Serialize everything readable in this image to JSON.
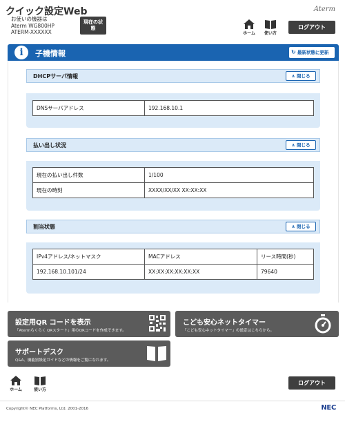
{
  "header": {
    "app_title": "クイック設定Web",
    "device_label": "お使いの機器は",
    "device_model": "Aterm WG800HP",
    "device_id": "ATERM-XXXXXX",
    "status_button": "現在の状態",
    "brand": "Aterm",
    "home_label": "ホーム",
    "help_label": "使い方",
    "logout_label": "ログアウト"
  },
  "main": {
    "title": "子機情報",
    "refresh_label": "最新状態に更新"
  },
  "sections": {
    "dhcp": {
      "title": "DHCPサーバ情報",
      "close_label": "閉じる",
      "rows": [
        {
          "label": "DNSサーバアドレス",
          "value": "192.168.10.1"
        }
      ]
    },
    "lease": {
      "title": "払い出し状況",
      "close_label": "閉じる",
      "rows": [
        {
          "label": "現在の払い出し件数",
          "value": "1/100"
        },
        {
          "label": "現在の時刻",
          "value": "XXXX/XX/XX XX:XX:XX"
        }
      ]
    },
    "assign": {
      "title": "割当状態",
      "close_label": "閉じる",
      "headers": [
        "IPv4アドレス/ネットマスク",
        "MACアドレス",
        "リース時間(秒)"
      ],
      "rows": [
        [
          "192.168.10.101/24",
          "XX:XX:XX:XX:XX:XX",
          "79640"
        ]
      ]
    }
  },
  "tiles": {
    "qr": {
      "title": "設定用QR コードを表示",
      "desc": "「Atermらくらく QRスタート」用のQRコードを作成できます。",
      "icon": "qr-code-icon"
    },
    "timer": {
      "title": "こども安心ネットタイマー",
      "desc": "「こども安心ネットタイマー」の設定はこちらから。",
      "icon": "stopwatch-icon"
    },
    "support": {
      "title": "サポートデスク",
      "desc": "Q&A、機能別設定ガイドなどの情報をご覧になれます。",
      "icon": "book-icon"
    }
  },
  "footer": {
    "home_label": "ホーム",
    "help_label": "使い方",
    "logout_label": "ログアウト",
    "copyright": "Copyright© NEC Platforms, Ltd. 2001-2016",
    "brand": "NEC"
  }
}
